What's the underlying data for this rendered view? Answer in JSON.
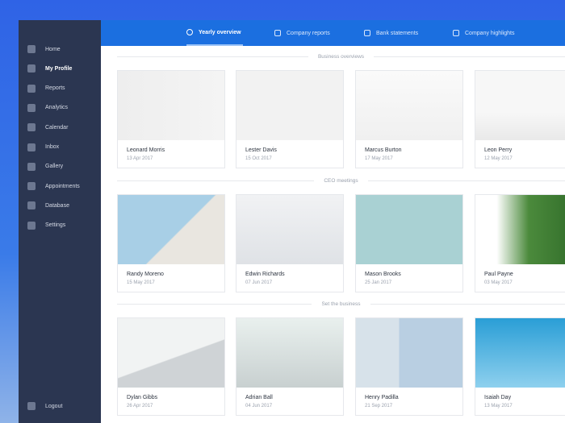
{
  "sidebar": {
    "items": [
      {
        "label": "Home",
        "icon": "home-icon"
      },
      {
        "label": "My Profile",
        "icon": "user-icon",
        "active": true
      },
      {
        "label": "Reports",
        "icon": "reports-icon"
      },
      {
        "label": "Analytics",
        "icon": "analytics-icon"
      },
      {
        "label": "Calendar",
        "icon": "calendar-icon"
      },
      {
        "label": "Inbox",
        "icon": "inbox-icon"
      },
      {
        "label": "Gallery",
        "icon": "gallery-icon"
      },
      {
        "label": "Appointments",
        "icon": "appointments-icon"
      },
      {
        "label": "Database",
        "icon": "database-icon"
      },
      {
        "label": "Settings",
        "icon": "gear-icon"
      }
    ],
    "logout": "Logout"
  },
  "tabs": [
    {
      "label": "Yearly overview",
      "active": true
    },
    {
      "label": "Company reports"
    },
    {
      "label": "Bank statements"
    },
    {
      "label": "Company highlights"
    }
  ],
  "sections": [
    {
      "title": "Business overviews",
      "cards": [
        {
          "name": "Leonard Morris",
          "date": "13 Apr 2017"
        },
        {
          "name": "Lester Davis",
          "date": "15 Oct 2017"
        },
        {
          "name": "Marcus Burton",
          "date": "17 May 2017"
        },
        {
          "name": "Leon Perry",
          "date": "12 May 2017"
        }
      ]
    },
    {
      "title": "CEO meetings",
      "cards": [
        {
          "name": "Randy Moreno",
          "date": "15 May 2017"
        },
        {
          "name": "Edwin Richards",
          "date": "07 Jun 2017"
        },
        {
          "name": "Mason Brooks",
          "date": "25 Jan 2017"
        },
        {
          "name": "Paul Payne",
          "date": "03 May 2017"
        }
      ]
    },
    {
      "title": "Set the business",
      "cards": [
        {
          "name": "Dylan Gibbs",
          "date": "26 Apr 2017"
        },
        {
          "name": "Adrian Ball",
          "date": "04 Jun 2017"
        },
        {
          "name": "Henry Padilla",
          "date": "21 Sep 2017"
        },
        {
          "name": "Isaiah Day",
          "date": "13 May 2017"
        }
      ]
    }
  ]
}
